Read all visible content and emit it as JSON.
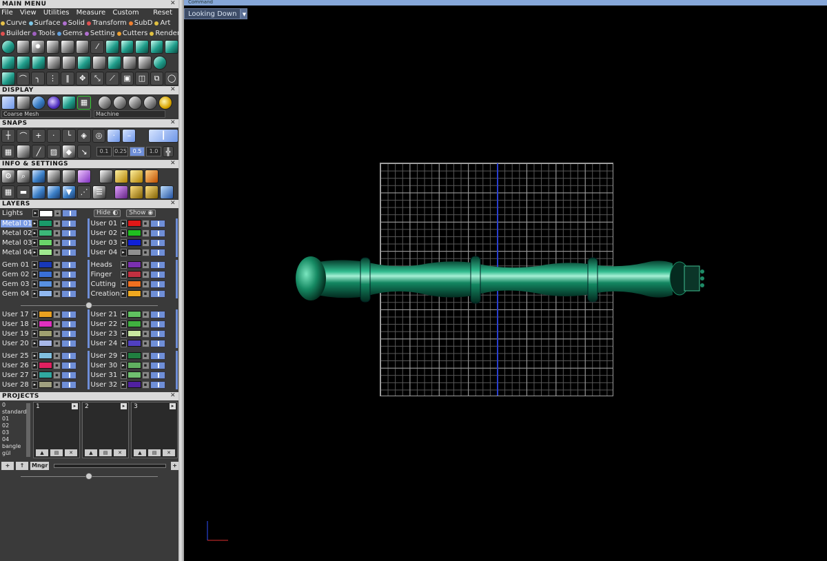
{
  "main_menu": {
    "title": "MAIN MENU",
    "menus": [
      "File",
      "View",
      "Utilities",
      "Measure",
      "Custom"
    ],
    "reset": "Reset",
    "plugins_row1": [
      {
        "label": "Curve",
        "color": "#e6c24a"
      },
      {
        "label": "Surface",
        "color": "#7ec8e8"
      },
      {
        "label": "Solid",
        "color": "#b070d0"
      },
      {
        "label": "Transform",
        "color": "#e05050"
      },
      {
        "label": "SubD",
        "color": "#f08030"
      },
      {
        "label": "Art",
        "color": "#e0c040"
      }
    ],
    "plugins_row2": [
      {
        "label": "Builder",
        "color": "#e05050"
      },
      {
        "label": "Tools",
        "color": "#a060c0"
      },
      {
        "label": "Gems",
        "color": "#60a0e0"
      },
      {
        "label": "Setting",
        "color": "#b070d0"
      },
      {
        "label": "Cutters",
        "color": "#f0a030"
      },
      {
        "label": "Render",
        "color": "#e0c040"
      }
    ]
  },
  "display": {
    "title": "DISPLAY",
    "mesh_dropdown": "Coarse Mesh",
    "material_dropdown": "Machine"
  },
  "snaps": {
    "title": "SNAPS",
    "values": [
      "0.1",
      "0.25",
      "0.5",
      "1.0"
    ],
    "active_value": "0.5"
  },
  "info_settings": {
    "title": "INFO & SETTINGS"
  },
  "layers": {
    "title": "LAYERS",
    "lights_label": "Lights",
    "hide_label": "Hide",
    "show_label": "Show",
    "groups": [
      {
        "left": [
          {
            "name": "Metal 01",
            "color": "#1a9a6a",
            "selected": true
          },
          {
            "name": "Metal 02",
            "color": "#3cb878"
          },
          {
            "name": "Metal 03",
            "color": "#6ad46a"
          },
          {
            "name": "Metal 04",
            "color": "#a0e890"
          }
        ],
        "right": [
          {
            "name": "User 01",
            "color": "#e01818"
          },
          {
            "name": "User 02",
            "color": "#20c020"
          },
          {
            "name": "User 03",
            "color": "#1020d8"
          },
          {
            "name": "User 04",
            "color": "#909090"
          }
        ]
      },
      {
        "left": [
          {
            "name": "Gem 01",
            "color": "#1838b8"
          },
          {
            "name": "Gem 02",
            "color": "#3a70d8"
          },
          {
            "name": "Gem 03",
            "color": "#5890e0"
          },
          {
            "name": "Gem 04",
            "color": "#90b8f0"
          }
        ],
        "right": [
          {
            "name": "Heads",
            "color": "#7a30b0"
          },
          {
            "name": "Finger",
            "color": "#c03040"
          },
          {
            "name": "Cutting",
            "color": "#f07020"
          },
          {
            "name": "Creation",
            "color": "#f0a820"
          }
        ]
      },
      {
        "left": [
          {
            "name": "User 17",
            "color": "#e8a020"
          },
          {
            "name": "User 18",
            "color": "#e030c0"
          },
          {
            "name": "User 19",
            "color": "#a0a070"
          },
          {
            "name": "User 20",
            "color": "#a8b8e8"
          }
        ],
        "right": [
          {
            "name": "User 21",
            "color": "#60c060"
          },
          {
            "name": "User 22",
            "color": "#40b040"
          },
          {
            "name": "User 23",
            "color": "#c8e8a0"
          },
          {
            "name": "User 24",
            "color": "#5040c0"
          }
        ]
      },
      {
        "left": [
          {
            "name": "User 25",
            "color": "#80c0e0"
          },
          {
            "name": "User 26",
            "color": "#e02060"
          },
          {
            "name": "User 27",
            "color": "#30a8a0"
          },
          {
            "name": "User 28",
            "color": "#a0a080"
          }
        ],
        "right": [
          {
            "name": "User 29",
            "color": "#208040"
          },
          {
            "name": "User 30",
            "color": "#60b060"
          },
          {
            "name": "User 31",
            "color": "#70c070"
          },
          {
            "name": "User 32",
            "color": "#5020a0"
          }
        ]
      }
    ]
  },
  "projects": {
    "title": "PROJECTS",
    "list": [
      "0 standard",
      "01",
      "02",
      "03",
      "04",
      "bangle",
      "gül"
    ],
    "slots": [
      "1",
      "2",
      "3"
    ],
    "mngr_label": "Mngr"
  },
  "viewport": {
    "command_label": "Command",
    "view_name": "Looking Down",
    "model_color": "#0f7a5a"
  }
}
